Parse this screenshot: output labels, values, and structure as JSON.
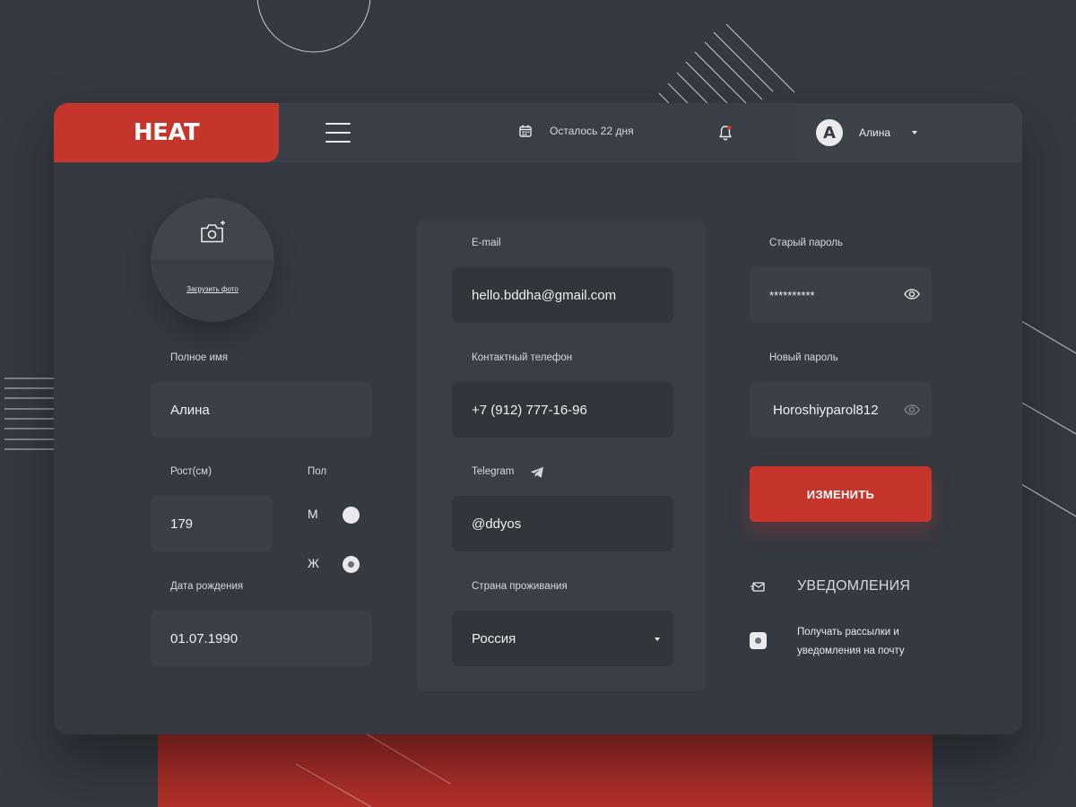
{
  "app": {
    "logo": "HEAT"
  },
  "header": {
    "trial_text": "Осталось 22 дня",
    "user": {
      "avatar_letter": "A",
      "name": "Алина"
    }
  },
  "profile": {
    "upload_photo": "Загрузить фото",
    "full_name": {
      "label": "Полное имя",
      "value": "Алина"
    },
    "height": {
      "label": "Рост(см)",
      "value": "179"
    },
    "gender": {
      "label": "Пол",
      "options": [
        {
          "label": "М",
          "selected": false
        },
        {
          "label": "Ж",
          "selected": true
        }
      ]
    },
    "birth_date": {
      "label": "Дата рождения",
      "value": "01.07.1990"
    }
  },
  "contacts": {
    "email": {
      "label": "E-mail",
      "value": "hello.bddha@gmail.com"
    },
    "phone": {
      "label": "Контактный телефон",
      "value": "+7 (912) 777-16-96"
    },
    "telegram": {
      "label": "Telegram",
      "value": "@ddyos"
    },
    "country": {
      "label": "Страна проживания",
      "value": "Россия"
    }
  },
  "password": {
    "old": {
      "label": "Старый пароль",
      "value": "**********"
    },
    "new": {
      "label": "Новый пароль",
      "value": "Horoshiyparol812"
    },
    "submit_label": "ИЗМЕНИТЬ"
  },
  "notifications": {
    "title": "УВЕДОМЛЕНИЯ",
    "subscribe_text": "Получать рассылки и уведомления на почту",
    "subscribe_checked": true
  },
  "colors": {
    "accent": "#c6352c",
    "background": "#353941",
    "field": "#3b3f47",
    "notification_dot": "#d9342b"
  }
}
